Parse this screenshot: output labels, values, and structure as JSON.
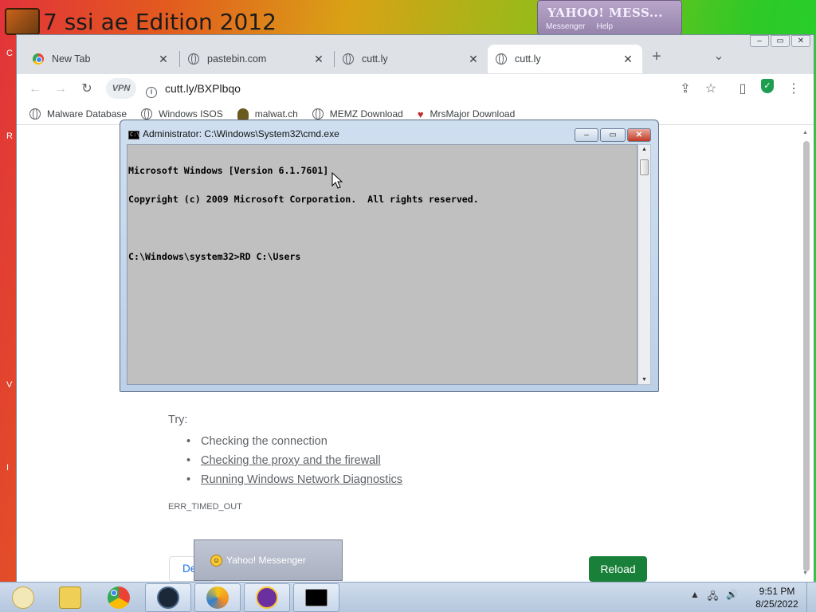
{
  "desktop": {
    "title": "7 ssi ae Edition 2012",
    "yahoo_mini": {
      "name": "YAHOO! MESS...",
      "menu": [
        "Messenger",
        "Help"
      ]
    },
    "left_letters": [
      "C",
      "R",
      "V",
      "I"
    ]
  },
  "browser": {
    "tabs": [
      {
        "label": "New Tab",
        "icon": "chrome-icon",
        "active": false
      },
      {
        "label": "pastebin.com",
        "icon": "globe-icon",
        "active": false
      },
      {
        "label": "cutt.ly",
        "icon": "globe-icon",
        "active": false
      },
      {
        "label": "cutt.ly",
        "icon": "globe-icon",
        "active": true
      }
    ],
    "new_tab_symbol": "+",
    "tab_search_symbol": "⌄",
    "close_symbol": "✕",
    "toolbar": {
      "vpn_label": "VPN",
      "url": "cutt.ly/BXPlbqo"
    },
    "bookmarks": [
      {
        "label": "Malware Database",
        "icon": "globe-icon"
      },
      {
        "label": "Windows ISOS",
        "icon": "globe-icon"
      },
      {
        "label": "malwat.ch",
        "icon": "person-icon"
      },
      {
        "label": "MEMZ Download",
        "icon": "globe-icon"
      },
      {
        "label": "MrsMajor Download",
        "icon": "heart-icon"
      }
    ],
    "page": {
      "try_label": "Try:",
      "suggestions": [
        {
          "text": "Checking the connection",
          "link": false
        },
        {
          "text": "Checking the proxy and the firewall",
          "link": true
        },
        {
          "text": "Running Windows Network Diagnostics",
          "link": true
        }
      ],
      "error_code": "ERR_TIMED_OUT",
      "details_label": "Details",
      "reload_label": "Reload"
    }
  },
  "cmd": {
    "title": "Administrator: C:\\Windows\\System32\\cmd.exe",
    "lines": [
      "Microsoft Windows [Version 6.1.7601]",
      "Copyright (c) 2009 Microsoft Corporation.  All rights reserved.",
      "",
      "C:\\Windows\\system32>RD C:\\Users"
    ]
  },
  "yahoo_popup": {
    "label": "Yahoo! Messenger"
  },
  "taskbar": {
    "apps": [
      "smiley-icon",
      "folder-icon",
      "chrome-icon",
      "steam-icon",
      "security-icon",
      "yahoo-icon",
      "cmd-icon"
    ],
    "time": "9:51 PM",
    "date": "8/25/2022"
  },
  "colors": {
    "reload_green": "#188038",
    "console_bg": "#c0c0c0"
  }
}
